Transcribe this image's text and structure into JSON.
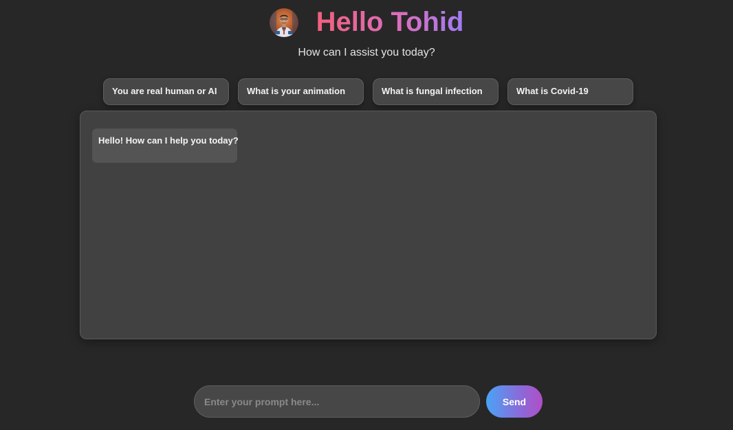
{
  "header": {
    "title": "Hello Tohid",
    "subtitle": "How can I assist you today?",
    "avatar_icon": "person-portrait-icon"
  },
  "suggestions": [
    {
      "label": "You are real human or AI"
    },
    {
      "label": "What is your animation"
    },
    {
      "label": "What is fungal infection"
    },
    {
      "label": "What is Covid-19"
    }
  ],
  "chat": {
    "messages": [
      {
        "sender": "bot",
        "text": "Hello! How can I help you today?"
      }
    ]
  },
  "composer": {
    "input_value": "",
    "input_placeholder": "Enter your prompt here...",
    "send_label": "Send"
  },
  "colors": {
    "background": "#272727",
    "title_gradient_start": "#f35f7e",
    "title_gradient_end": "#a07cf3",
    "send_gradient_start": "#4aa3f5",
    "send_gradient_end": "#b04fc7"
  }
}
